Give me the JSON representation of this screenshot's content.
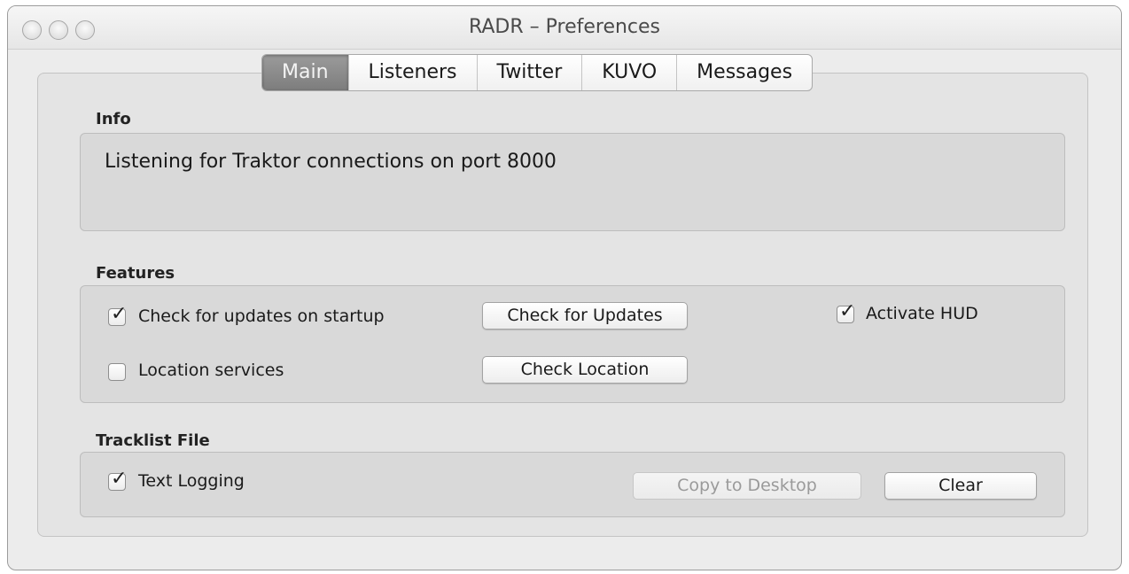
{
  "window": {
    "title": "RADR – Preferences"
  },
  "tabs": [
    {
      "label": "Main",
      "active": true
    },
    {
      "label": "Listeners",
      "active": false
    },
    {
      "label": "Twitter",
      "active": false
    },
    {
      "label": "KUVO",
      "active": false
    },
    {
      "label": "Messages",
      "active": false
    }
  ],
  "info": {
    "heading": "Info",
    "text": "Listening for Traktor connections on port 8000"
  },
  "features": {
    "heading": "Features",
    "check_updates_on_startup": {
      "label": "Check for updates on startup",
      "checked": true
    },
    "check_updates_button": "Check for Updates",
    "activate_hud": {
      "label": "Activate HUD",
      "checked": true
    },
    "location_services": {
      "label": "Location services",
      "checked": false
    },
    "check_location_button": "Check Location"
  },
  "tracklist": {
    "heading": "Tracklist File",
    "text_logging": {
      "label": "Text Logging",
      "checked": true
    },
    "copy_to_desktop_button": "Copy to Desktop",
    "clear_button": "Clear"
  }
}
